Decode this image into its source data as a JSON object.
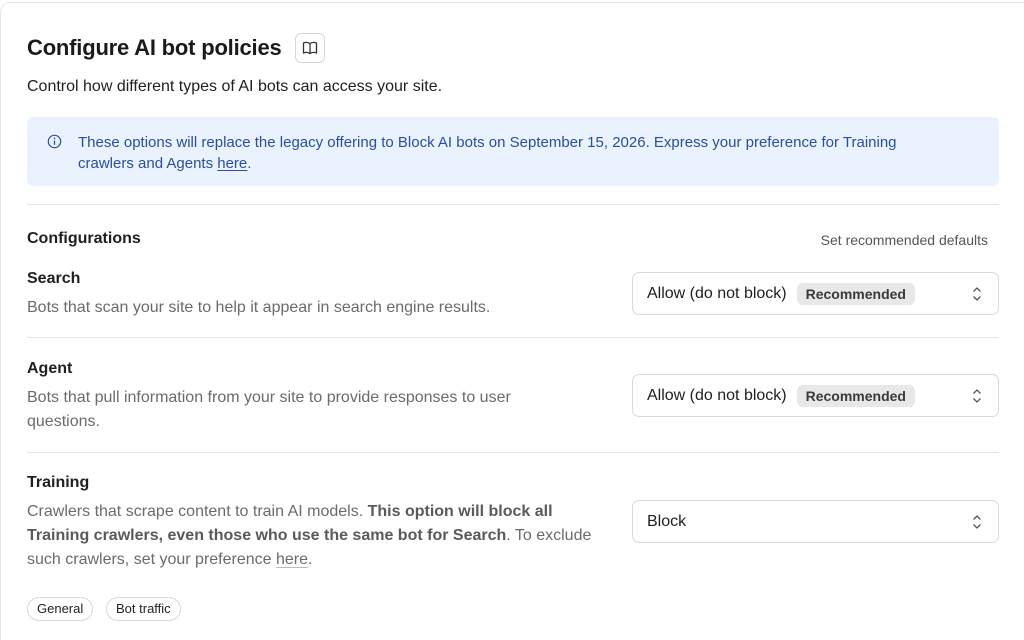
{
  "header": {
    "title": "Configure AI bot policies",
    "docs_icon": "book-icon",
    "subtitle": "Control how different types of AI bots can access your site."
  },
  "notice": {
    "icon": "info-icon",
    "text_before": "These options will replace the legacy offering to Block AI bots on September 15, 2026. Express your preference for Training crawlers and Agents ",
    "link": "here",
    "text_after": "."
  },
  "configurations": {
    "title": "Configurations",
    "defaults_link": "Set recommended defaults",
    "rows": [
      {
        "title": "Search",
        "description": "Bots that scan your site to help it appear in search engine results.",
        "value": "Allow (do not block)",
        "badge": "Recommended"
      },
      {
        "title": "Agent",
        "description": "Bots that pull information from your site to provide responses to user questions.",
        "value": "Allow (do not block)",
        "badge": "Recommended"
      },
      {
        "title": "Training",
        "desc_part1": "Crawlers that scrape content to train AI models. ",
        "desc_bold": "This option will block all Training crawlers, even those who use the same bot for Search",
        "desc_part2": ". To exclude such crawlers, set your preference ",
        "desc_link": "here",
        "desc_end": ".",
        "value": "Block"
      }
    ]
  },
  "tags": [
    "General",
    "Bot traffic"
  ],
  "colors": {
    "notice_bg": "#eaf2fd",
    "notice_text": "#2a4f9e",
    "badge_bg": "#e8e8e8"
  }
}
